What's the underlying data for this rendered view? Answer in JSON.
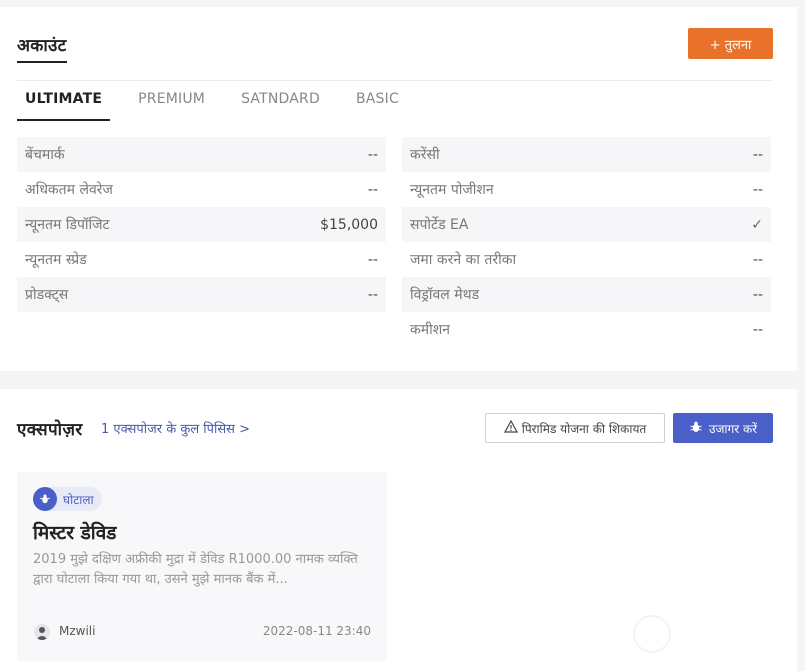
{
  "account": {
    "title": "अकाउंट",
    "compare_label": "+ तुलना",
    "tabs": [
      "ULTIMATE",
      "PREMIUM",
      "SATNDARD",
      "BASIC"
    ],
    "left_rows": [
      {
        "key": "बेंचमार्क",
        "value": "--"
      },
      {
        "key": "अधिकतम लेवरेज",
        "value": "--"
      },
      {
        "key": "न्यूनतम डिपॉजिट",
        "value": "$15,000"
      },
      {
        "key": "न्यूनतम स्प्रेड",
        "value": "--"
      },
      {
        "key": "प्रोडक्ट्स",
        "value": "--"
      }
    ],
    "right_rows": [
      {
        "key": "करेंसी",
        "value": "--"
      },
      {
        "key": "न्यूनतम पोजीशन",
        "value": "--"
      },
      {
        "key": "सपोर्टेड EA",
        "value": "✓"
      },
      {
        "key": "जमा करने का तरीका",
        "value": "--"
      },
      {
        "key": "विड्रॉवल मेथड",
        "value": "--"
      },
      {
        "key": "कमीशन",
        "value": "--"
      }
    ]
  },
  "exposure": {
    "title": "एक्सपोज़र",
    "summary_link": "1 एक्सपोजर के कुल पिसिस >",
    "complaint_label": "पिरामिड योजना की शिकायत",
    "expose_label": "उजागर करें",
    "post": {
      "tag": "घोटाला",
      "title": "मिस्टर डेविड",
      "body": "2019 मुझे दक्षिण अफ्रीकी मुद्रा में डेविड R1000.00 नामक व्यक्ति द्वारा घोटाला किया गया था, उसने मुझे मानक बैंक में...",
      "author": "Mzwili",
      "date": "2022-08-11 23:40"
    }
  },
  "colors": {
    "accent_orange": "#e8722a",
    "accent_blue": "#4b5fc8"
  }
}
